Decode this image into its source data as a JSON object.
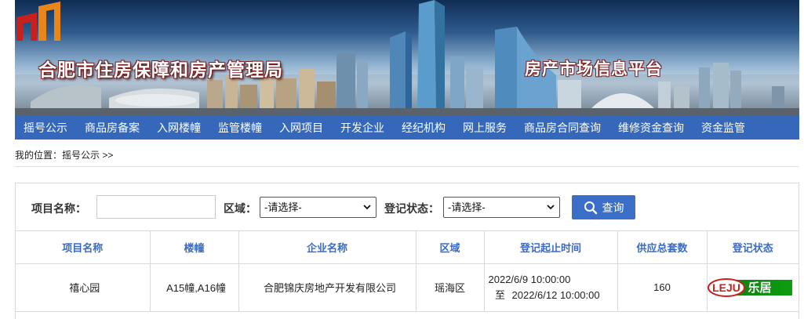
{
  "banner": {
    "site_title": "合肥市住房保障和房产管理局",
    "platform_title": "房产市场信息平台",
    "colors": {
      "title_stroke": "#7a1e1e",
      "logo_red": "#c8201d",
      "logo_orange": "#e8861a"
    }
  },
  "nav": {
    "color": "#3568bb",
    "items": [
      "摇号公示",
      "商品房备案",
      "入网楼幢",
      "监管楼幢",
      "入网项目",
      "开发企业",
      "经纪机构",
      "网上服务",
      "商品房合同查询",
      "维修资金查询",
      "资金监管"
    ]
  },
  "breadcrumb": "我的位置：摇号公示 >>",
  "filter": {
    "project_label": "项目名称：",
    "project_value": "",
    "region_label": "区域：",
    "region_selected": "-请选择-",
    "status_label": "登记状态：",
    "status_selected": "-请选择-",
    "search_label": "查询",
    "search_icon": "search-icon",
    "button_color": "#3b6fc7"
  },
  "table": {
    "columns": [
      "项目名称",
      "楼幢",
      "企业名称",
      "区域",
      "登记起止时间",
      "供应总套数",
      "登记状态"
    ],
    "header_color": "#3a6bc4",
    "rows": [
      {
        "project": "禧心园",
        "buildings": "A15幢,A16幢",
        "company": "合肥锦庆房地产开发有限公司",
        "region": "瑶海区",
        "start": "2022/6/9 10:00:00",
        "end_prefix": "至",
        "end": "2022/6/12 10:00:00",
        "total": "160",
        "status_badge_text": "乐居"
      }
    ]
  }
}
